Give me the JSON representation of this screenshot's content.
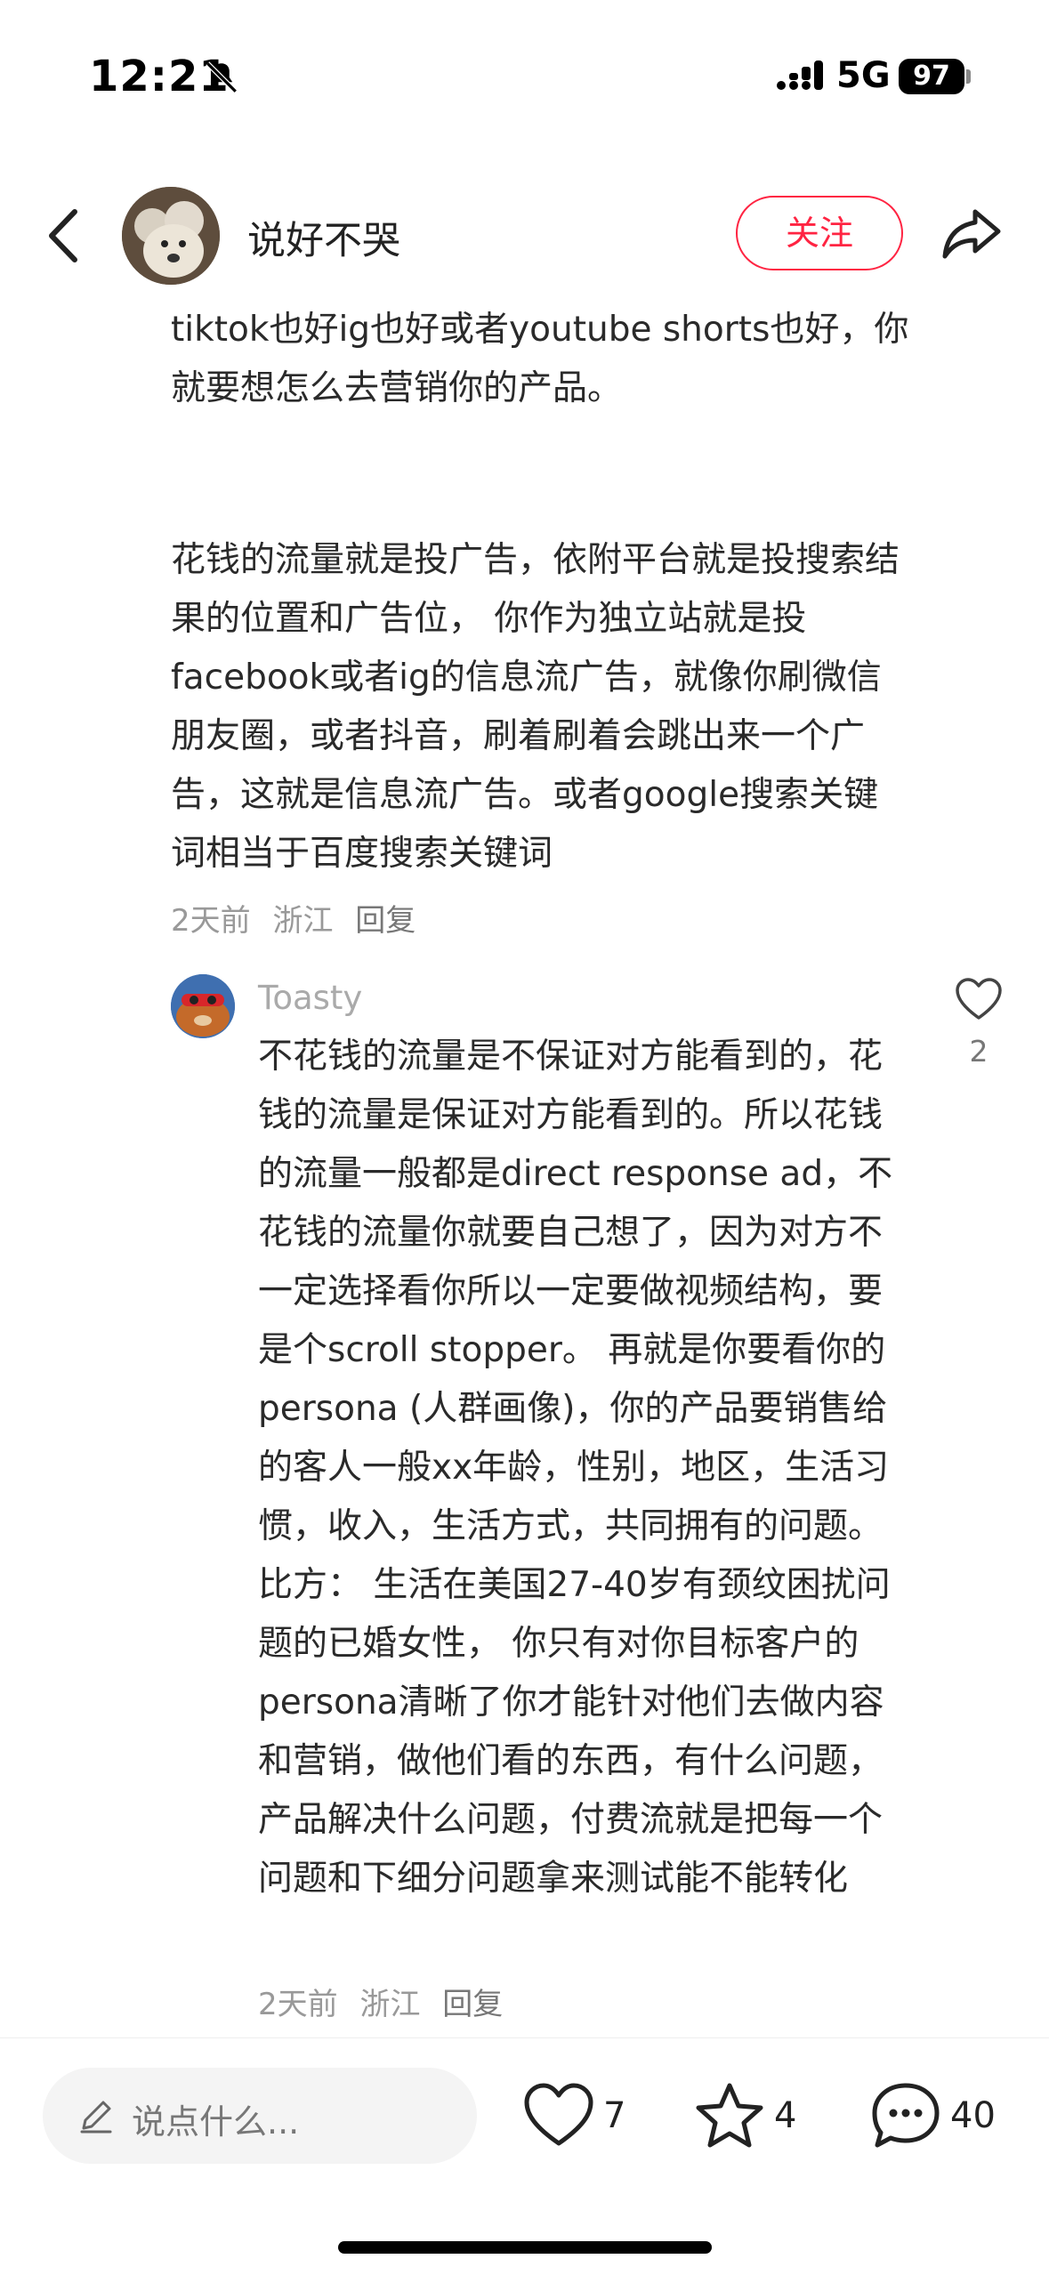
{
  "status_bar": {
    "time": "12:21",
    "network": "5G",
    "battery": "97"
  },
  "header": {
    "author_name": "说好不哭",
    "follow_label": "关注"
  },
  "post": {
    "paragraph_1": "tiktok也好ig也好或者youtube shorts也好，你就要想怎么去营销你的产品。",
    "paragraph_2": "花钱的流量就是投广告，依附平台就是投搜索结果的位置和广告位， 你作为独立站就是投facebook或者ig的信息流广告，就像你刷微信朋友圈，或者抖音，刷着刷着会跳出来一个广告，这就是信息流广告。或者google搜索关键词相当于百度搜索关键词",
    "meta": {
      "time": "2天前",
      "location": "浙江",
      "reply": "回复"
    }
  },
  "sub_comment": {
    "author": "Toasty",
    "likes": "2",
    "text": "不花钱的流量是不保证对方能看到的，花钱的流量是保证对方能看到的。所以花钱的流量一般都是direct response ad，不花钱的流量你就要自己想了，因为对方不一定选择看你所以一定要做视频结构，要是个scroll stopper。 再就是你要看你的persona (人群画像)，你的产品要销售给的客人一般xx年龄，性别，地区，生活习惯，收入，生活方式，共同拥有的问题。 比方： 生活在美国27-40岁有颈纹困扰问题的已婚女性， 你只有对你目标客户的persona清晰了你才能针对他们去做内容和营销，做他们看的东西，有什么问题，产品解决什么问题，付费流就是把每一个问题和下细分问题拿来测试能不能转化",
    "meta": {
      "time": "2天前",
      "location": "浙江",
      "reply": "回复"
    }
  },
  "bottom_bar": {
    "input_placeholder": "说点什么...",
    "likes": "7",
    "stars": "4",
    "comments": "40"
  },
  "colors": {
    "accent": "#ff2442"
  },
  "icons": [
    "bell-muted-icon",
    "signal-icon",
    "back-chevron-icon",
    "share-icon",
    "heart-icon",
    "pencil-icon",
    "star-icon",
    "comment-bubble-icon"
  ]
}
